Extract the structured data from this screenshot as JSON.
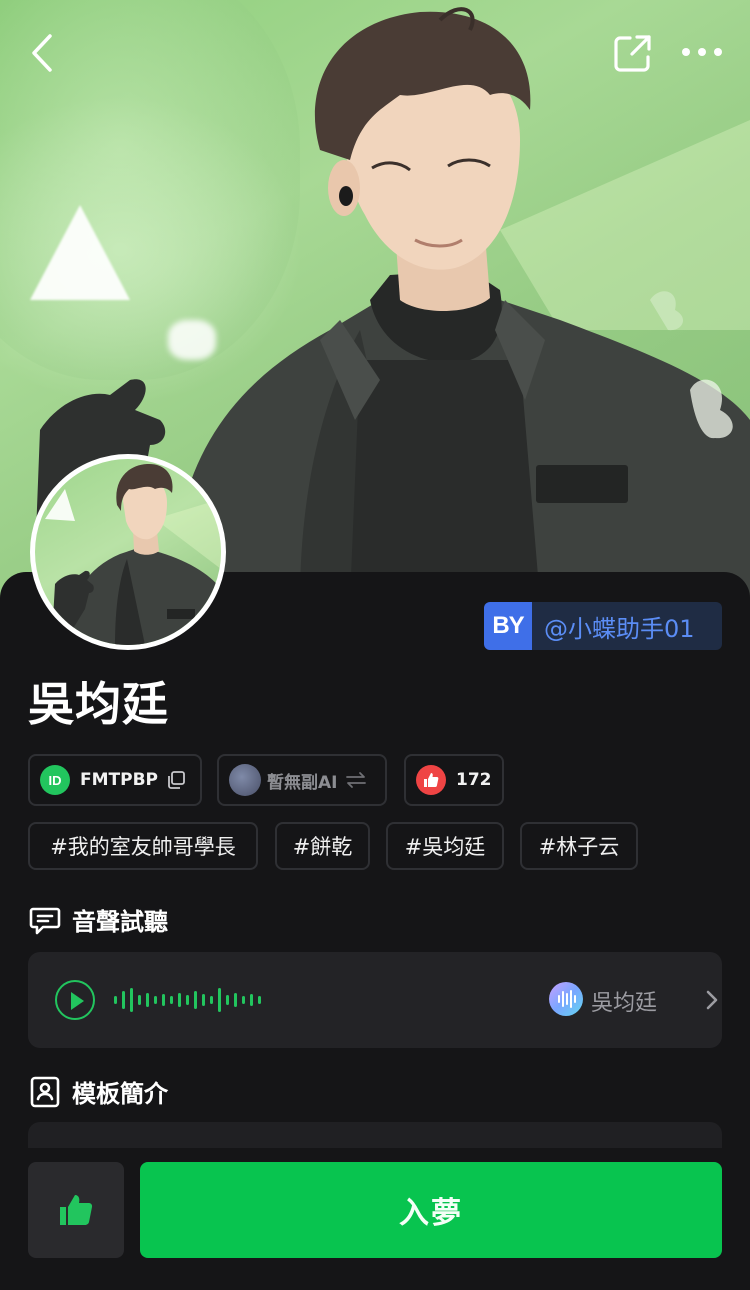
{
  "header": {
    "back_icon": "chevron-left-icon",
    "share_icon": "share-external-icon",
    "more_icon": "more-horizontal-icon"
  },
  "creator": {
    "by_label": "BY",
    "handle": "@小蝶助手01"
  },
  "character": {
    "name": "吳均廷"
  },
  "chips": {
    "id_icon_label": "ID",
    "id_value": "FMTPBP",
    "id_copy_icon": "copy-icon",
    "sub_ai_label": "暫無副AI",
    "sub_ai_switch_icon": "swap-arrows-icon",
    "likes_icon": "thumbs-up-icon",
    "likes_count": "172"
  },
  "tags": [
    "#我的室友帥哥學長",
    "#餅乾",
    "#吳均廷",
    "#林子云"
  ],
  "voice_section": {
    "title": "音聲試聽",
    "icon": "message-square-icon",
    "voice_name": "吳均廷",
    "play_icon": "play-circle-icon",
    "waveform_icon": "waveform-icon",
    "chevron_icon": "chevron-right-icon"
  },
  "intro_section": {
    "title": "模板簡介",
    "icon": "id-card-icon"
  },
  "actions": {
    "like_icon": "thumbs-up-icon",
    "enter_label": "入夢"
  },
  "colors": {
    "accent_green": "#08c44f",
    "creator_blue": "#3f6fe8",
    "background": "#151517"
  }
}
